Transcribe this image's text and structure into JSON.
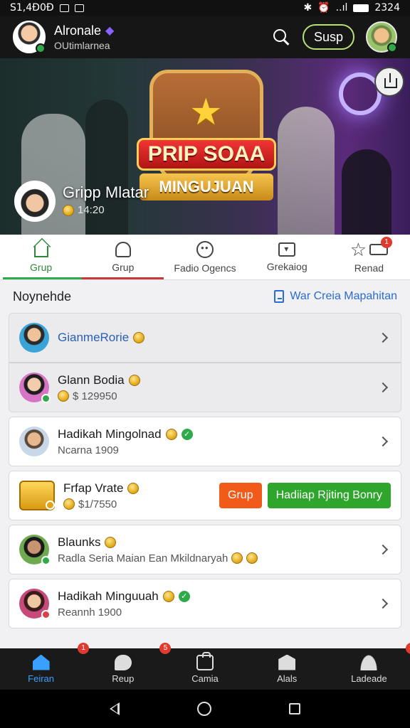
{
  "statusbar": {
    "left_text": "S1,4Ð0Ð",
    "right_text": "2324",
    "signal_text": "..ıl"
  },
  "header": {
    "name": "Alronale",
    "subtitle": "OUtimlarnea",
    "action_label": "Susp"
  },
  "banner": {
    "badge_title": "PRIP SOAA",
    "badge_subtitle": "MINGUJUAN",
    "title": "Gripp Mlatar",
    "value": "14:20"
  },
  "tabs": [
    {
      "label": "Grup",
      "icon": "home-icon"
    },
    {
      "label": "Grup",
      "icon": "ghost-icon"
    },
    {
      "label": "Fadio Ogencs",
      "icon": "chat-icon"
    },
    {
      "label": "Grekaiog",
      "icon": "tv-icon"
    },
    {
      "label": "Renad",
      "icon": "star-icon",
      "badge": "1"
    }
  ],
  "section": {
    "title": "Noynehde",
    "link": "War Creia Mapahitan"
  },
  "rows": [
    {
      "name": "GianmeRorie",
      "sub": ""
    },
    {
      "name": "Glann Bodia",
      "sub": "$ 129950"
    },
    {
      "name": "Hadikah Mingolnad",
      "sub": "Ncarna 1909"
    },
    {
      "name": "Frfap Vrate",
      "sub": "$1/7550",
      "btn1": "Grup",
      "btn2": "Hadiiap Rjiting Bonry"
    },
    {
      "name": "Blaunks",
      "sub": "Radla Seria Maian Ean Mkildnaryah"
    },
    {
      "name": "Hadikah Minguuah",
      "sub": "Reannh 1900"
    }
  ],
  "bottomnav": [
    {
      "label": "Feiran",
      "icon": "home-icon",
      "badge": "1"
    },
    {
      "label": "Reup",
      "icon": "chat-icon",
      "badge": "5"
    },
    {
      "label": "Camia",
      "icon": "bag-icon"
    },
    {
      "label": "Alals",
      "icon": "box-icon"
    },
    {
      "label": "Ladeade",
      "icon": "user-icon",
      "badge": "3"
    }
  ],
  "colors": {
    "accent_green": "#2faa4b",
    "link_blue": "#2a6bd6",
    "orange": "#f25a1a",
    "nav_active": "#3aa0ff"
  }
}
